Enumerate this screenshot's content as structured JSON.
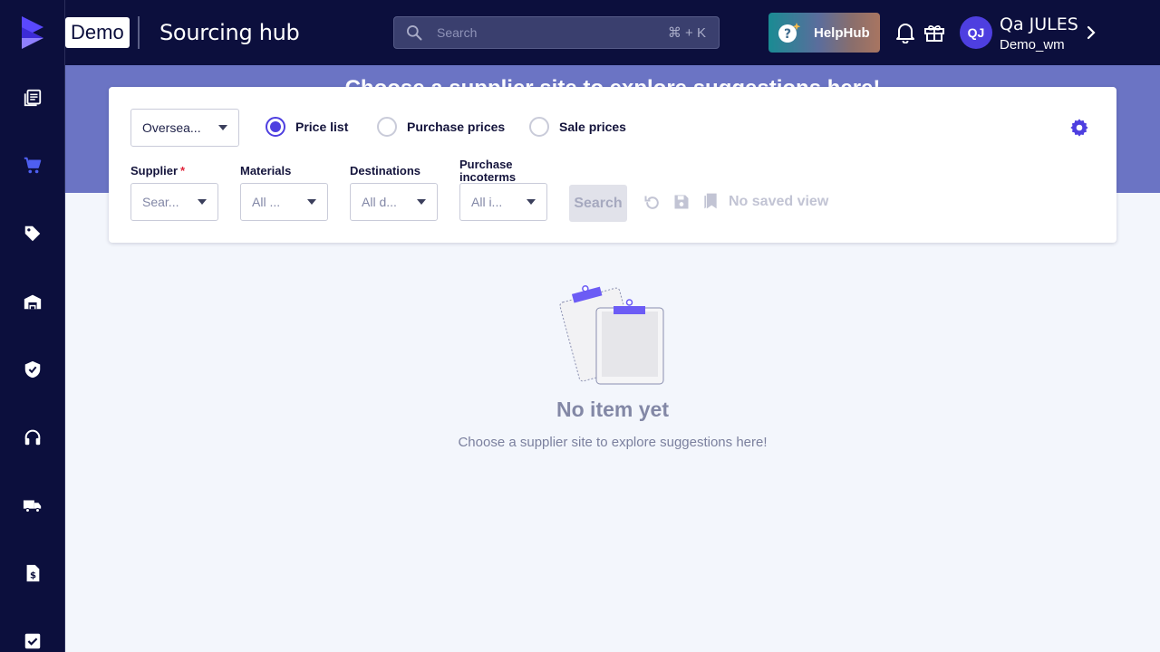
{
  "sidebar": {
    "items": [
      {
        "icon": "catalog-icon",
        "name": "sidebar-item-catalog"
      },
      {
        "icon": "cart-icon",
        "name": "sidebar-item-sourcing"
      },
      {
        "icon": "tag-icon",
        "name": "sidebar-item-prices"
      },
      {
        "icon": "warehouse-icon",
        "name": "sidebar-item-warehouse"
      },
      {
        "icon": "shield-check-icon",
        "name": "sidebar-item-quality"
      },
      {
        "icon": "headset-icon",
        "name": "sidebar-item-support"
      },
      {
        "icon": "truck-icon",
        "name": "sidebar-item-transport"
      },
      {
        "icon": "invoice-icon",
        "name": "sidebar-item-invoices"
      },
      {
        "icon": "checkbox-icon",
        "name": "sidebar-item-tasks"
      }
    ],
    "active_color": "#4e3fe0"
  },
  "header": {
    "workspace_badge": "Demo",
    "title": "Sourcing hub",
    "search_placeholder": "Search",
    "search_shortcut": "⌘ + K",
    "helphub_label": "HelpHub",
    "user_initials": "QJ",
    "user_name": "Qa JULES",
    "user_org": "Demo_wm"
  },
  "hero": {
    "title": "Choose a supplier site to explore suggestions here!"
  },
  "filters": {
    "site_select": "Oversea...",
    "price_mode": {
      "options": [
        "Price list",
        "Purchase prices",
        "Sale prices"
      ],
      "selected": "Price list"
    },
    "supplier": {
      "label": "Supplier",
      "required_mark": "*",
      "placeholder": "Sear..."
    },
    "materials": {
      "label": "Materials",
      "placeholder": "All ..."
    },
    "destinations": {
      "label": "Destinations",
      "placeholder": "All d..."
    },
    "incoterms": {
      "label": "Purchase incoterms",
      "placeholder": "All i..."
    },
    "search_button": "Search",
    "saved_view": "No saved view"
  },
  "empty_state": {
    "title": "No item yet",
    "subtitle": "Choose a supplier site to explore suggestions here!"
  },
  "colors": {
    "nav_bg": "#0c0f3d",
    "hero_bg": "#6b74c4",
    "accent": "#4e3fe0",
    "page_bg": "#f3f6fc"
  }
}
